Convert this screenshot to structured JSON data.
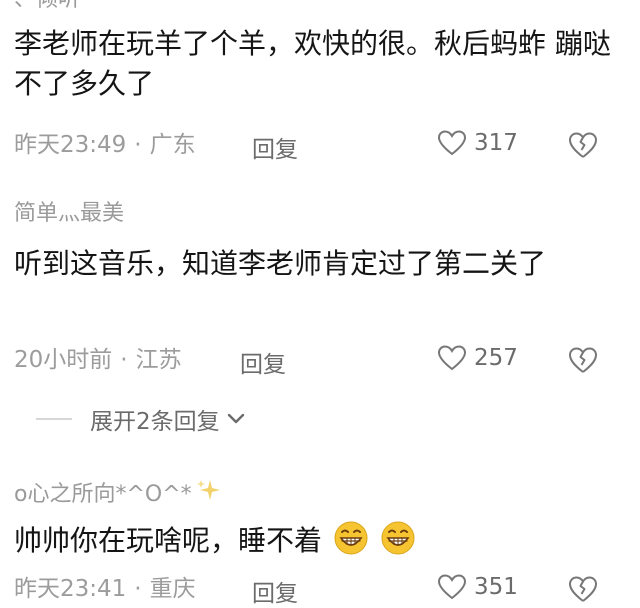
{
  "comments": [
    {
      "username": "、倾听",
      "text": "李老师在玩羊了个羊，欢快的很。秋后蚂蚱 蹦哒不了多久了",
      "time": "昨天23:49",
      "location": "广东",
      "reply_label": "回复",
      "likes": "317"
    },
    {
      "username": "简单灬最美",
      "text": "听到这音乐，知道李老师肯定过了第二关了",
      "time": "20小时前",
      "location": "江苏",
      "reply_label": "回复",
      "likes": "257",
      "expand_label": "展开2条回复"
    },
    {
      "username": "o心之所向*^O^*",
      "text": "帅帅你在玩啥呢，睡不着",
      "time": "昨天23:41",
      "location": "重庆",
      "reply_label": "回复",
      "likes": "351"
    }
  ],
  "separator": "·",
  "icons": {
    "like": "heart-outline-icon",
    "dislike": "broken-heart-icon",
    "expand": "chevron-down-icon",
    "sparkle": "sparkle-icon",
    "emoji": "grinning-face-icon"
  },
  "colors": {
    "text": "#151515",
    "meta": "#9c9c9c",
    "action": "#6b6b6b",
    "emoji": "#f6c431",
    "sparkle": "#f2d36b"
  }
}
